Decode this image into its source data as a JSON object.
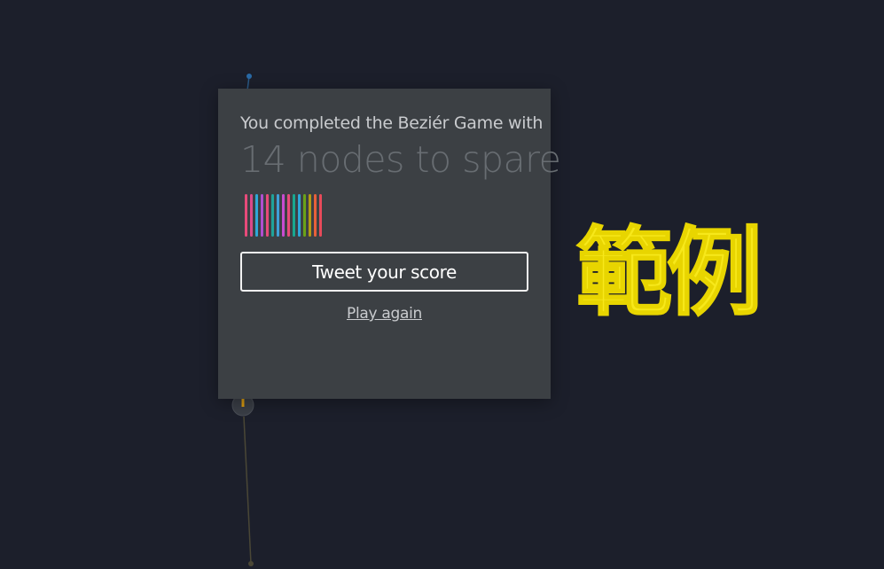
{
  "modal": {
    "completed_text": "You completed the Beziér Game with",
    "score_text": "14 nodes to spare",
    "tweet_label": "Tweet your score",
    "play_again_label": "Play again",
    "node_bar_colors": [
      "#e84a7a",
      "#d94a8c",
      "#2ea8d8",
      "#b04fd0",
      "#e84a7a",
      "#1fa39a",
      "#3fa0d8",
      "#c84bd0",
      "#e84a7a",
      "#18a890",
      "#2ea8d8",
      "#6aa218",
      "#b59a12",
      "#e8603a",
      "#e84a5a"
    ]
  },
  "watermark": {
    "text": "範例"
  },
  "colors": {
    "background": "#1c1f2b",
    "modal_background": "#3c4044",
    "watermark": "#f7e81a"
  }
}
